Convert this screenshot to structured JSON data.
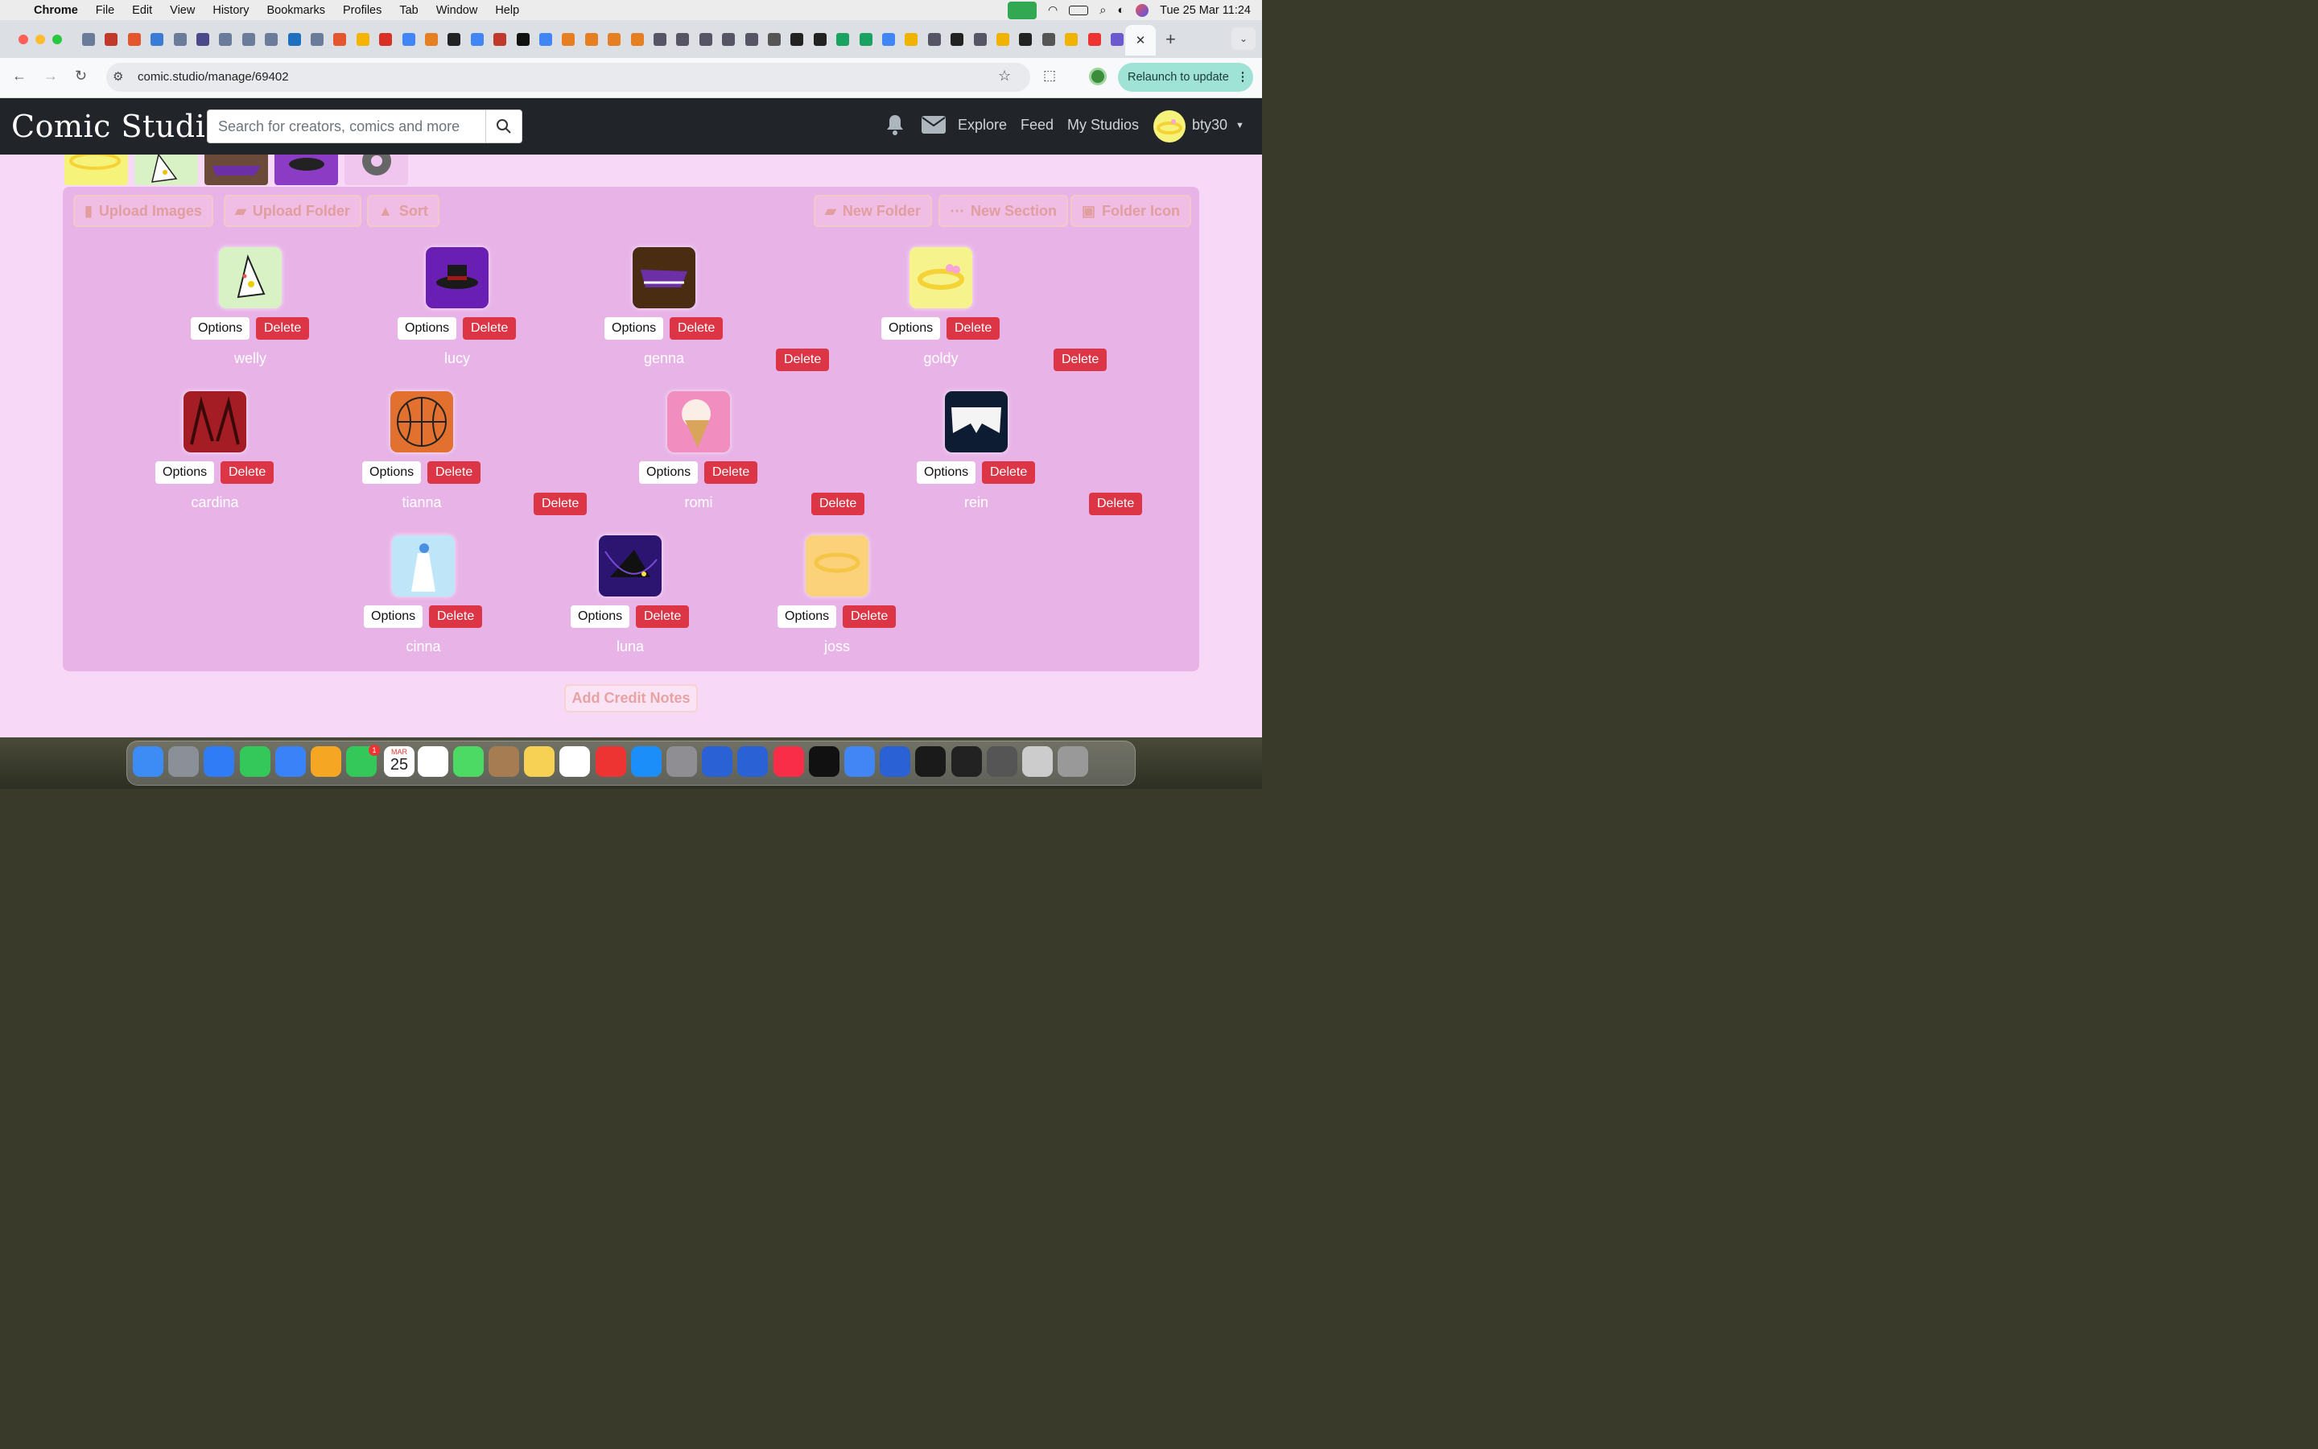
{
  "menubar": {
    "app": "Chrome",
    "items": [
      "File",
      "Edit",
      "View",
      "History",
      "Bookmarks",
      "Profiles",
      "Tab",
      "Window",
      "Help"
    ],
    "datetime": "Tue 25 Mar  11:24"
  },
  "browser": {
    "url": "comic.studio/manage/69402",
    "relaunch_label": "Relaunch to update",
    "close_tab_glyph": "✕",
    "new_tab_glyph": "+"
  },
  "site": {
    "logo": "Comic Studio",
    "search_placeholder": "Search for creators, comics and more",
    "nav": {
      "explore": "Explore",
      "feed": "Feed",
      "my_studios": "My Studios"
    },
    "username": "bty30"
  },
  "toolbar": {
    "upload_images": "Upload Images",
    "upload_folder": "Upload Folder",
    "sort": "Sort",
    "new_folder": "New Folder",
    "new_section": "New Section",
    "folder_icon": "Folder Icon"
  },
  "labels": {
    "options": "Options",
    "delete": "Delete"
  },
  "characters": [
    {
      "name": "welly",
      "bg": "#d8f2c6"
    },
    {
      "name": "lucy",
      "bg": "#6a1fb4"
    },
    {
      "name": "genna",
      "bg": "#4a2c12"
    },
    {
      "name": "goldy",
      "bg": "#f7f38c"
    },
    {
      "name": "cardina",
      "bg": "#a51d24"
    },
    {
      "name": "tianna",
      "bg": "#e2702e"
    },
    {
      "name": "romi",
      "bg": "#f28dbf"
    },
    {
      "name": "rein",
      "bg": "#0d1b33"
    },
    {
      "name": "cinna",
      "bg": "#bfe6f8"
    },
    {
      "name": "luna",
      "bg": "#2b1570"
    },
    {
      "name": "joss",
      "bg": "#fbd27a"
    }
  ],
  "credit_notes": "Add Credit Notes",
  "dock": {
    "calendar_month": "MAR",
    "calendar_day": "25",
    "badge": "1"
  }
}
